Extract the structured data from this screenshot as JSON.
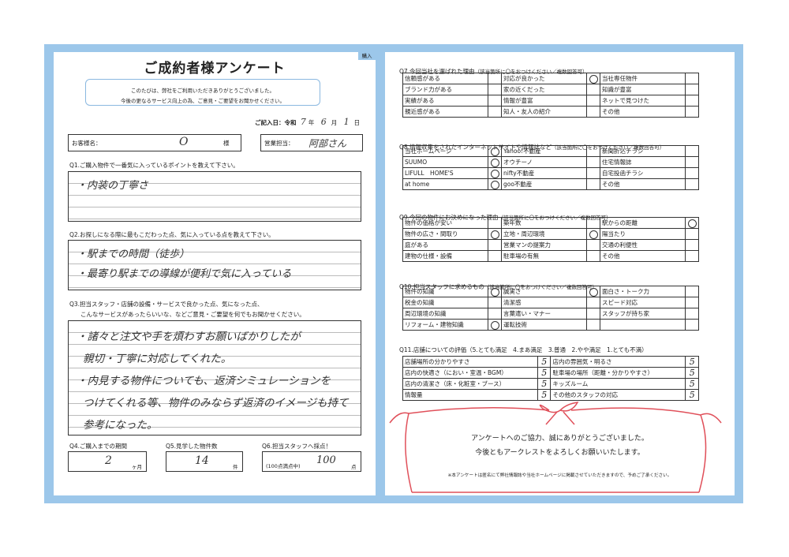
{
  "left": {
    "badge": "購入",
    "title": "ご成約者様アンケート",
    "intro": [
      "このたびは、弊社をご利用いただきありがとうございました。",
      "今後の更なるサービス向上の為、ご意見・ご要望をお聞かせください。"
    ],
    "date": {
      "label": "ご記入日：令和",
      "year": "7",
      "year_unit": "年",
      "month": "6",
      "month_unit": "月",
      "day": "1",
      "day_unit": "日"
    },
    "customer": {
      "label": "お客様名：",
      "value": "O",
      "suffix": "様"
    },
    "staff": {
      "label": "営業担当：",
      "value": "阿部さん"
    },
    "q1": {
      "question": "Q1.ご購入物件で一番気に入っているポイントを教えて下さい。",
      "answer": "・内装の丁寧さ"
    },
    "q2": {
      "question": "Q2.お探しになる際に最もこだわった点、気に入っている点を教えて下さい。",
      "answer": [
        "・駅までの時間（徒歩）",
        "・最寄り駅までの導線が便利で気に入っている"
      ]
    },
    "q3": {
      "question": [
        "Q3.担当スタッフ・店舗の設備・サービスで良かった点、気になった点、",
        "こんなサービスがあったらいいな、などご意見・ご要望を何でもお聞かせください。"
      ],
      "answer": [
        "・諸々と注文や手を煩わすお願いばかりしたが",
        "親切・丁寧に対応してくれた。",
        "・内見する物件についても、返済シミュレーションを",
        "つけてくれる等、物件のみならず返済のイメージも持て",
        "参考になった。"
      ]
    },
    "q4": {
      "label": "Q4.ご購入までの期間",
      "value": "2",
      "unit": "ヶ月"
    },
    "q5": {
      "label": "Q5.見学した物件数",
      "value": "14",
      "unit": "件"
    },
    "q6": {
      "label": "Q6.担当スタッフへ採点！",
      "prefix": "(100点満点中)",
      "value": "100",
      "unit": "点"
    }
  },
  "right": {
    "q7": {
      "title": "Q7.今回当社を選ばれた理由",
      "note": "（該当箇所に〇をおつけください／複数回答可）",
      "rows": [
        [
          {
            "t": "信頼感がある",
            "m": ""
          },
          {
            "t": "対応が良かった",
            "m": "O"
          },
          {
            "t": "当社専任物件",
            "m": ""
          }
        ],
        [
          {
            "t": "ブランド力がある",
            "m": ""
          },
          {
            "t": "家の近くだった",
            "m": ""
          },
          {
            "t": "知識が豊富",
            "m": ""
          }
        ],
        [
          {
            "t": "実績がある",
            "m": ""
          },
          {
            "t": "情報が豊富",
            "m": ""
          },
          {
            "t": "ネットで見つけた",
            "m": ""
          }
        ],
        [
          {
            "t": "親近感がある",
            "m": ""
          },
          {
            "t": "知人・友人の紹介",
            "m": ""
          },
          {
            "t": "その他",
            "m": ""
          }
        ]
      ]
    },
    "q8": {
      "title": "Q8.情報収集をされたインターネットサイトや情報誌など",
      "note": "（該当箇所に〇をおつけください／複数回答可）",
      "rows": [
        [
          {
            "t": "当社ホームページ",
            "m": "O"
          },
          {
            "t": "Yahoo!不動産",
            "m": ""
          },
          {
            "t": "新聞折込チラシ",
            "m": ""
          }
        ],
        [
          {
            "t": "SUUMO",
            "m": "O"
          },
          {
            "t": "オウチーノ",
            "m": ""
          },
          {
            "t": "住宅情報誌",
            "m": ""
          }
        ],
        [
          {
            "t": "LIFULL　HOME'S",
            "m": "O"
          },
          {
            "t": "nifty不動産",
            "m": ""
          },
          {
            "t": "自宅投函チラシ",
            "m": ""
          }
        ],
        [
          {
            "t": "at home",
            "m": "O"
          },
          {
            "t": "goo不動産",
            "m": ""
          },
          {
            "t": "その他",
            "m": ""
          }
        ]
      ]
    },
    "q9": {
      "title": "Q9.今回の物件にお決めになった理由",
      "note": "（該当箇所に〇をおつけください／複数回答可）",
      "rows": [
        [
          {
            "t": "物件の価格が安い",
            "m": ""
          },
          {
            "t": "築年数",
            "m": ""
          },
          {
            "t": "駅からの距離",
            "m": "O"
          }
        ],
        [
          {
            "t": "物件の広さ・間取り",
            "m": "O"
          },
          {
            "t": "立地・周辺環境",
            "m": "O"
          },
          {
            "t": "陽当たり",
            "m": ""
          }
        ],
        [
          {
            "t": "庭がある",
            "m": ""
          },
          {
            "t": "営業マンの提案力",
            "m": ""
          },
          {
            "t": "交通の利便性",
            "m": ""
          }
        ],
        [
          {
            "t": "建物の仕様・設備",
            "m": ""
          },
          {
            "t": "駐車場の有無",
            "m": ""
          },
          {
            "t": "その他",
            "m": ""
          }
        ]
      ]
    },
    "q10": {
      "title": "Q10.担当スタッフに求めるもの",
      "note": "（該当箇所に〇をおつけください／複数回答可）",
      "rows": [
        [
          {
            "t": "物件の知識",
            "m": "O"
          },
          {
            "t": "誠実さ",
            "m": "O"
          },
          {
            "t": "面白さ・トーク力",
            "m": ""
          }
        ],
        [
          {
            "t": "税金の知識",
            "m": ""
          },
          {
            "t": "清潔感",
            "m": ""
          },
          {
            "t": "スピード対応",
            "m": ""
          }
        ],
        [
          {
            "t": "周辺環境の知識",
            "m": ""
          },
          {
            "t": "言葉遣い・マナー",
            "m": ""
          },
          {
            "t": "スタッフが持ち家",
            "m": ""
          }
        ],
        [
          {
            "t": "リフォーム・建物知識",
            "m": "O"
          },
          {
            "t": "運転技術",
            "m": ""
          },
          {
            "t": "",
            "m": ""
          }
        ]
      ]
    },
    "q11": {
      "title": "Q11.店舗についての評価（5.とても満足　4.まあ満足　3.普通　2.やや満足　1.とても不満）",
      "rows": [
        [
          {
            "t": "店舗場所の分かりやすさ",
            "s": "5"
          },
          {
            "t": "店内の雰囲気・明るさ",
            "s": "5"
          }
        ],
        [
          {
            "t": "店内の快適さ（におい・室温・BGM）",
            "s": "5"
          },
          {
            "t": "駐車場の場所（距離・分かりやすさ）",
            "s": "5"
          }
        ],
        [
          {
            "t": "店内の清潔さ（床・化粧室・ブース）",
            "s": "5"
          },
          {
            "t": "キッズルーム",
            "s": "5"
          }
        ],
        [
          {
            "t": "情報量",
            "s": "5"
          },
          {
            "t": "その他のスタッフの対応",
            "s": "5"
          }
        ]
      ]
    },
    "thanks": [
      "アンケートへのご協力、誠にありがとうございました。",
      "今後ともアークレストをよろしくお願いいたします。"
    ],
    "footnote": "※本アンケートは匿名にて弊社情報誌や当社ホームページに掲載させていただきますので、予めご了承ください。"
  },
  "colors": {
    "frame": "#9cc7ea",
    "ribbon": "#e0505a"
  }
}
